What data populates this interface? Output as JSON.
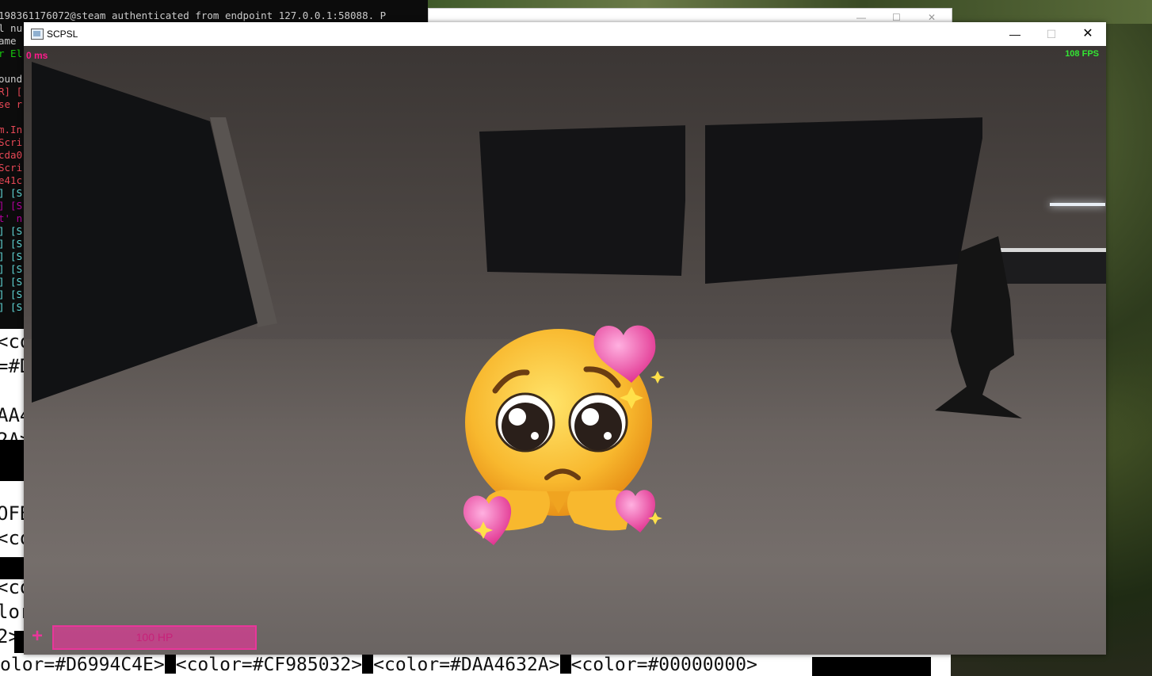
{
  "console": {
    "header_line": "198361176072@steam authenticated from endpoint 127.0.0.1:58088. P",
    "lines": [
      {
        "text": "l nu",
        "color": "#cccccc"
      },
      {
        "text": "ame",
        "color": "#cccccc"
      },
      {
        "text": "r El",
        "color": "#16c60c"
      },
      {
        "text": "",
        "color": "#cccccc"
      },
      {
        "text": "ound",
        "color": "#cccccc"
      },
      {
        "text": "R] [",
        "color": "#e74856"
      },
      {
        "text": "se r",
        "color": "#e74856"
      },
      {
        "text": "",
        "color": "#cccccc"
      },
      {
        "text": "m.In",
        "color": "#e74856"
      },
      {
        "text": "Scri",
        "color": "#e74856"
      },
      {
        "text": "cda0",
        "color": "#e74856"
      },
      {
        "text": "Scri",
        "color": "#e74856"
      },
      {
        "text": "e41c",
        "color": "#e74856"
      },
      {
        "text": "] [S",
        "color": "#61d6d6"
      },
      {
        "text": "] [S",
        "color": "#b4009e"
      },
      {
        "text": "t' n",
        "color": "#b4009e"
      },
      {
        "text": "] [S",
        "color": "#61d6d6"
      },
      {
        "text": "] [S",
        "color": "#61d6d6"
      },
      {
        "text": "] [S",
        "color": "#61d6d6"
      },
      {
        "text": "] [S",
        "color": "#61d6d6"
      },
      {
        "text": "] [S",
        "color": "#61d6d6"
      },
      {
        "text": "] [S",
        "color": "#61d6d6"
      },
      {
        "text": "] [S",
        "color": "#61d6d6"
      }
    ],
    "big_lines": [
      "<co",
      "=#D",
      "",
      "AA4",
      "2A>",
      "",
      "",
      "OFB",
      "<co",
      "",
      "<co",
      "lor",
      "2>"
    ],
    "bottom": {
      "t1": "olor=#D6994C4E>",
      "t2": "<color=#CF985032>",
      "t3": "<color=#DAA4632A>",
      "t4": "<color=#00000000>"
    }
  },
  "window": {
    "title": "SCPSL",
    "minimize": "—",
    "maximize": "☐",
    "close": "✕"
  },
  "hud": {
    "ping": "0 ms",
    "fps": "108 FPS",
    "hp_icon": "+",
    "hp_text": "100 HP"
  }
}
